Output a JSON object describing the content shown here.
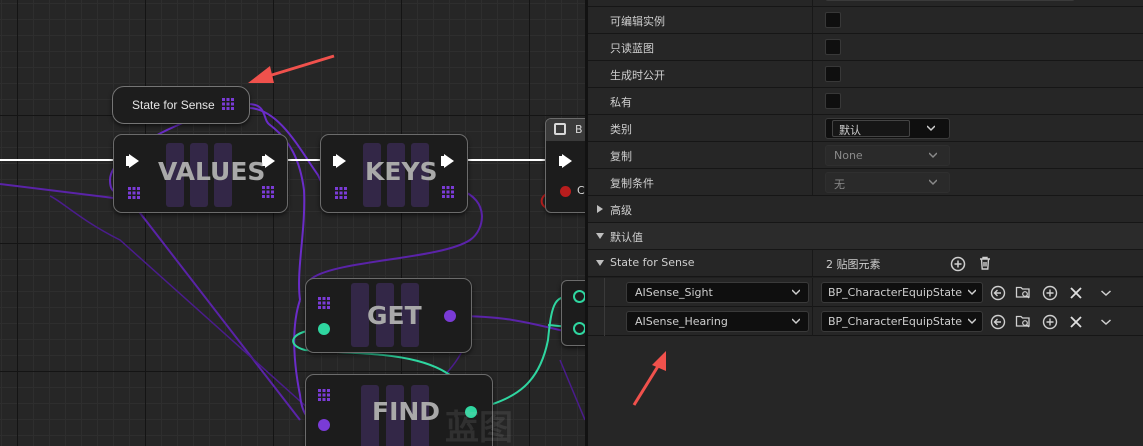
{
  "graph": {
    "variable_node_label": "State for Sense",
    "nodes": {
      "values": "VALUES",
      "keys": "KEYS",
      "get": "GET",
      "find": "FIND",
      "branch_partial": "B",
      "branch_pin_partial": "C"
    },
    "watermark": "蓝图"
  },
  "panel": {
    "rows": {
      "editable_instance": "可编辑实例",
      "readonly_blueprint": "只读蓝图",
      "expose_on_spawn": "生成时公开",
      "private": "私有",
      "category": "类别",
      "category_value": "默认",
      "replication": "复制",
      "replication_value": "None",
      "replication_condition": "复制条件",
      "replication_condition_value": "无"
    },
    "sections": {
      "advanced": "高级",
      "default_value": "默认值"
    },
    "map": {
      "name": "State for Sense",
      "count": "2 贴图元素",
      "entries": [
        {
          "key": "AISense_Sight",
          "value": "BP_CharacterEquipState"
        },
        {
          "key": "AISense_Hearing",
          "value": "BP_CharacterEquipState"
        }
      ]
    }
  },
  "colors": {
    "map_pin": "#7a3bd6",
    "teal_pin": "#2fd6a0",
    "annotation_arrow": "#f0514c",
    "exec_wire": "#ffffff"
  }
}
